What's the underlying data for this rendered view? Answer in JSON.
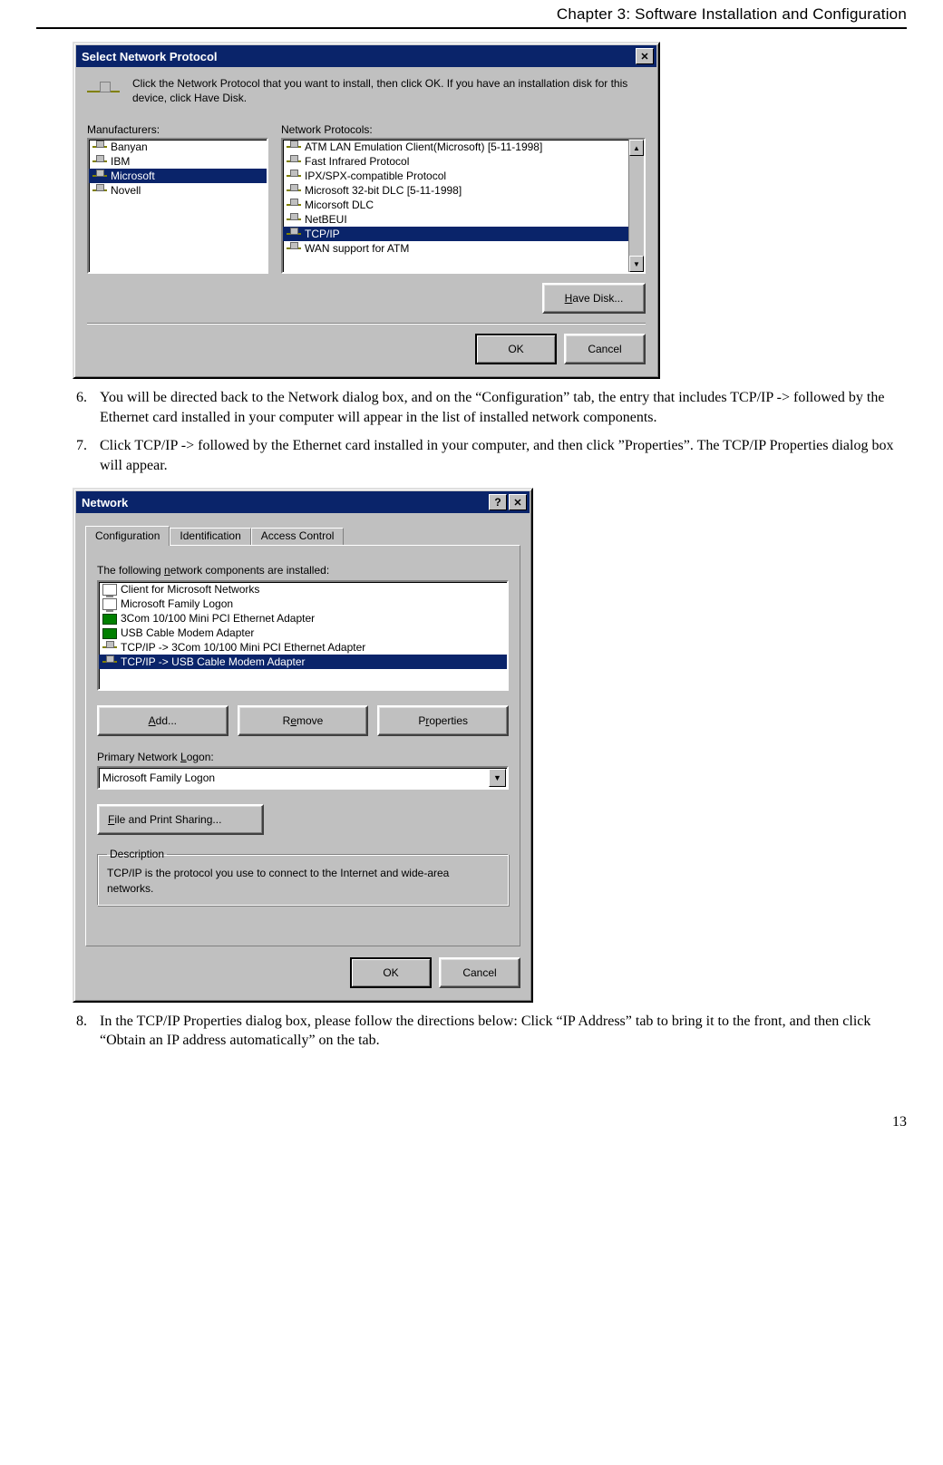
{
  "chapter_title": "Chapter 3: Software Installation and Configuration",
  "page_number": "13",
  "steps": {
    "s6": {
      "num": "6.",
      "text": "You will be directed back to the Network dialog box, and on the “Configuration” tab, the entry that includes TCP/IP -> followed by the Ethernet card installed in your computer will appear in the list of installed network components."
    },
    "s7": {
      "num": "7.",
      "text": "Click TCP/IP -> followed by the Ethernet card installed in your computer, and then click ”Properties”. The TCP/IP Properties dialog box will appear."
    },
    "s8": {
      "num": "8.",
      "text": "In the TCP/IP Properties dialog box, please follow the directions below: Click “IP Address” tab to bring it to the front, and then click “Obtain an IP address automatically” on the tab."
    }
  },
  "dlg1": {
    "title": "Select Network Protocol",
    "instruction": "Click the Network Protocol that you want to install, then click OK. If you have an installation disk for this device, click Have Disk.",
    "mfg_label": "Manufacturers:",
    "proto_label": "Network Protocols:",
    "manufacturers": [
      "Banyan",
      "IBM",
      "Microsoft",
      "Novell"
    ],
    "mfg_selected": "Microsoft",
    "protocols": [
      "ATM LAN Emulation Client(Microsoft) [5-11-1998]",
      "Fast Infrared Protocol",
      "IPX/SPX-compatible Protocol",
      "Microsoft 32-bit DLC        [5-11-1998]",
      "Micorsoft DLC",
      "NetBEUI",
      "TCP/IP",
      "WAN support for ATM"
    ],
    "proto_selected": "TCP/IP",
    "have_disk": "Have Disk...",
    "ok": "OK",
    "cancel": "Cancel"
  },
  "dlg2": {
    "title": "Network",
    "tabs": [
      "Configuration",
      "Identification",
      "Access Control"
    ],
    "list_label": "The following network components are installed:",
    "components": [
      {
        "icon": "mon",
        "text": "Client for Microsoft Networks"
      },
      {
        "icon": "mon",
        "text": "Microsoft Family Logon"
      },
      {
        "icon": "nic",
        "text": "3Com 10/100 Mini PCI Ethernet Adapter"
      },
      {
        "icon": "nic",
        "text": "USB Cable Modem Adapter"
      },
      {
        "icon": "proto",
        "text": "TCP/IP -> 3Com 10/100 Mini PCI Ethernet Adapter"
      },
      {
        "icon": "proto",
        "text": "TCP/IP -> USB Cable Modem Adapter"
      }
    ],
    "selected": "TCP/IP -> USB Cable Modem Adapter",
    "add": "Add...",
    "remove": "Remove",
    "properties": "Properties",
    "logon_label": "Primary Network Logon:",
    "logon_value": "Microsoft Family Logon",
    "file_print": "File and Print Sharing...",
    "desc_legend": "Description",
    "desc_text": "TCP/IP is the protocol you use to connect to the Internet and wide-area networks.",
    "ok": "OK",
    "cancel": "Cancel"
  }
}
